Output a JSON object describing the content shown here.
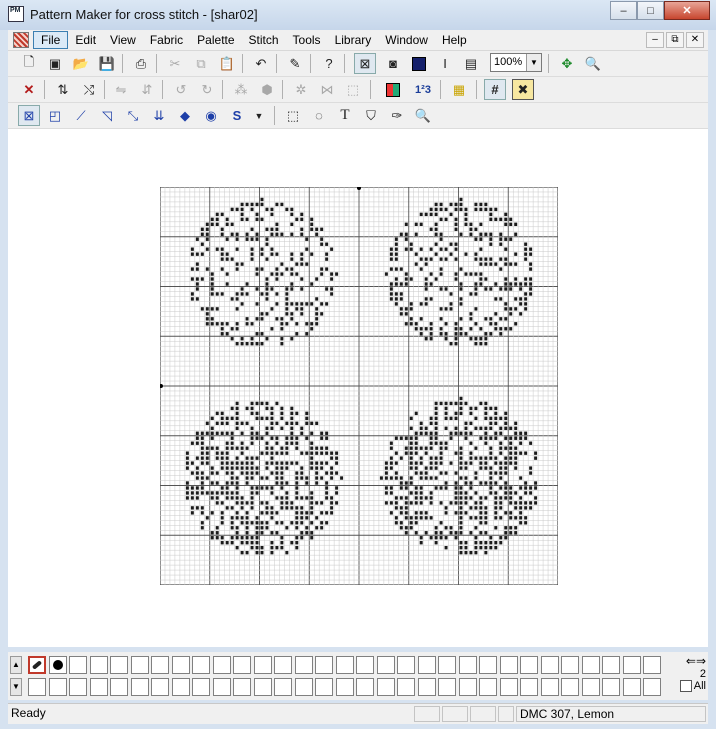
{
  "window": {
    "title": "Pattern Maker for cross stitch - [shar02]",
    "app_icon_text": "PM",
    "caption": {
      "minimize": "–",
      "maximize": "□",
      "close": "✕"
    }
  },
  "menu": {
    "items": [
      "File",
      "Edit",
      "View",
      "Fabric",
      "Palette",
      "Stitch",
      "Tools",
      "Library",
      "Window",
      "Help"
    ],
    "mdi": {
      "minimize": "–",
      "restore": "⧉",
      "close": "✕"
    }
  },
  "toolbar": {
    "zoom_value": "100%",
    "text_tool_label": "I",
    "row3_text_tool": "T",
    "row3_s_tool": "S",
    "numbers_tool": "1²3"
  },
  "palette": {
    "count_label": "2",
    "all_label": "All",
    "nav_arrows": "⇐⇒"
  },
  "status": {
    "left": "Ready",
    "right": "DMC 307, Lemon"
  },
  "grid": {
    "cells": 80,
    "stitch_color": "#1a1a1a",
    "major_every": 10
  }
}
